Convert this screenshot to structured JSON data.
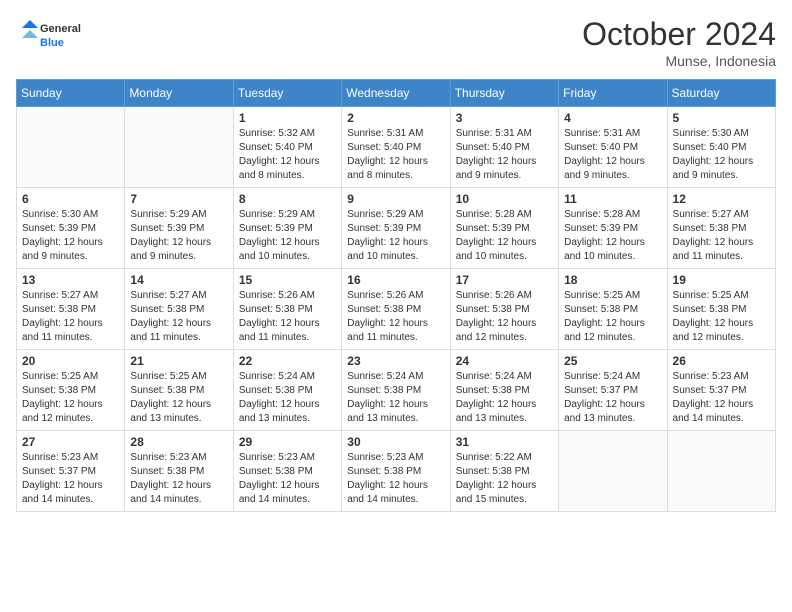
{
  "logo": {
    "general": "General",
    "blue": "Blue"
  },
  "header": {
    "month": "October 2024",
    "location": "Munse, Indonesia"
  },
  "days_of_week": [
    "Sunday",
    "Monday",
    "Tuesday",
    "Wednesday",
    "Thursday",
    "Friday",
    "Saturday"
  ],
  "weeks": [
    [
      {
        "day": "",
        "info": ""
      },
      {
        "day": "",
        "info": ""
      },
      {
        "day": "1",
        "info": "Sunrise: 5:32 AM\nSunset: 5:40 PM\nDaylight: 12 hours and 8 minutes."
      },
      {
        "day": "2",
        "info": "Sunrise: 5:31 AM\nSunset: 5:40 PM\nDaylight: 12 hours and 8 minutes."
      },
      {
        "day": "3",
        "info": "Sunrise: 5:31 AM\nSunset: 5:40 PM\nDaylight: 12 hours and 9 minutes."
      },
      {
        "day": "4",
        "info": "Sunrise: 5:31 AM\nSunset: 5:40 PM\nDaylight: 12 hours and 9 minutes."
      },
      {
        "day": "5",
        "info": "Sunrise: 5:30 AM\nSunset: 5:40 PM\nDaylight: 12 hours and 9 minutes."
      }
    ],
    [
      {
        "day": "6",
        "info": "Sunrise: 5:30 AM\nSunset: 5:39 PM\nDaylight: 12 hours and 9 minutes."
      },
      {
        "day": "7",
        "info": "Sunrise: 5:29 AM\nSunset: 5:39 PM\nDaylight: 12 hours and 9 minutes."
      },
      {
        "day": "8",
        "info": "Sunrise: 5:29 AM\nSunset: 5:39 PM\nDaylight: 12 hours and 10 minutes."
      },
      {
        "day": "9",
        "info": "Sunrise: 5:29 AM\nSunset: 5:39 PM\nDaylight: 12 hours and 10 minutes."
      },
      {
        "day": "10",
        "info": "Sunrise: 5:28 AM\nSunset: 5:39 PM\nDaylight: 12 hours and 10 minutes."
      },
      {
        "day": "11",
        "info": "Sunrise: 5:28 AM\nSunset: 5:39 PM\nDaylight: 12 hours and 10 minutes."
      },
      {
        "day": "12",
        "info": "Sunrise: 5:27 AM\nSunset: 5:38 PM\nDaylight: 12 hours and 11 minutes."
      }
    ],
    [
      {
        "day": "13",
        "info": "Sunrise: 5:27 AM\nSunset: 5:38 PM\nDaylight: 12 hours and 11 minutes."
      },
      {
        "day": "14",
        "info": "Sunrise: 5:27 AM\nSunset: 5:38 PM\nDaylight: 12 hours and 11 minutes."
      },
      {
        "day": "15",
        "info": "Sunrise: 5:26 AM\nSunset: 5:38 PM\nDaylight: 12 hours and 11 minutes."
      },
      {
        "day": "16",
        "info": "Sunrise: 5:26 AM\nSunset: 5:38 PM\nDaylight: 12 hours and 11 minutes."
      },
      {
        "day": "17",
        "info": "Sunrise: 5:26 AM\nSunset: 5:38 PM\nDaylight: 12 hours and 12 minutes."
      },
      {
        "day": "18",
        "info": "Sunrise: 5:25 AM\nSunset: 5:38 PM\nDaylight: 12 hours and 12 minutes."
      },
      {
        "day": "19",
        "info": "Sunrise: 5:25 AM\nSunset: 5:38 PM\nDaylight: 12 hours and 12 minutes."
      }
    ],
    [
      {
        "day": "20",
        "info": "Sunrise: 5:25 AM\nSunset: 5:38 PM\nDaylight: 12 hours and 12 minutes."
      },
      {
        "day": "21",
        "info": "Sunrise: 5:25 AM\nSunset: 5:38 PM\nDaylight: 12 hours and 13 minutes."
      },
      {
        "day": "22",
        "info": "Sunrise: 5:24 AM\nSunset: 5:38 PM\nDaylight: 12 hours and 13 minutes."
      },
      {
        "day": "23",
        "info": "Sunrise: 5:24 AM\nSunset: 5:38 PM\nDaylight: 12 hours and 13 minutes."
      },
      {
        "day": "24",
        "info": "Sunrise: 5:24 AM\nSunset: 5:38 PM\nDaylight: 12 hours and 13 minutes."
      },
      {
        "day": "25",
        "info": "Sunrise: 5:24 AM\nSunset: 5:37 PM\nDaylight: 12 hours and 13 minutes."
      },
      {
        "day": "26",
        "info": "Sunrise: 5:23 AM\nSunset: 5:37 PM\nDaylight: 12 hours and 14 minutes."
      }
    ],
    [
      {
        "day": "27",
        "info": "Sunrise: 5:23 AM\nSunset: 5:37 PM\nDaylight: 12 hours and 14 minutes."
      },
      {
        "day": "28",
        "info": "Sunrise: 5:23 AM\nSunset: 5:38 PM\nDaylight: 12 hours and 14 minutes."
      },
      {
        "day": "29",
        "info": "Sunrise: 5:23 AM\nSunset: 5:38 PM\nDaylight: 12 hours and 14 minutes."
      },
      {
        "day": "30",
        "info": "Sunrise: 5:23 AM\nSunset: 5:38 PM\nDaylight: 12 hours and 14 minutes."
      },
      {
        "day": "31",
        "info": "Sunrise: 5:22 AM\nSunset: 5:38 PM\nDaylight: 12 hours and 15 minutes."
      },
      {
        "day": "",
        "info": ""
      },
      {
        "day": "",
        "info": ""
      }
    ]
  ]
}
